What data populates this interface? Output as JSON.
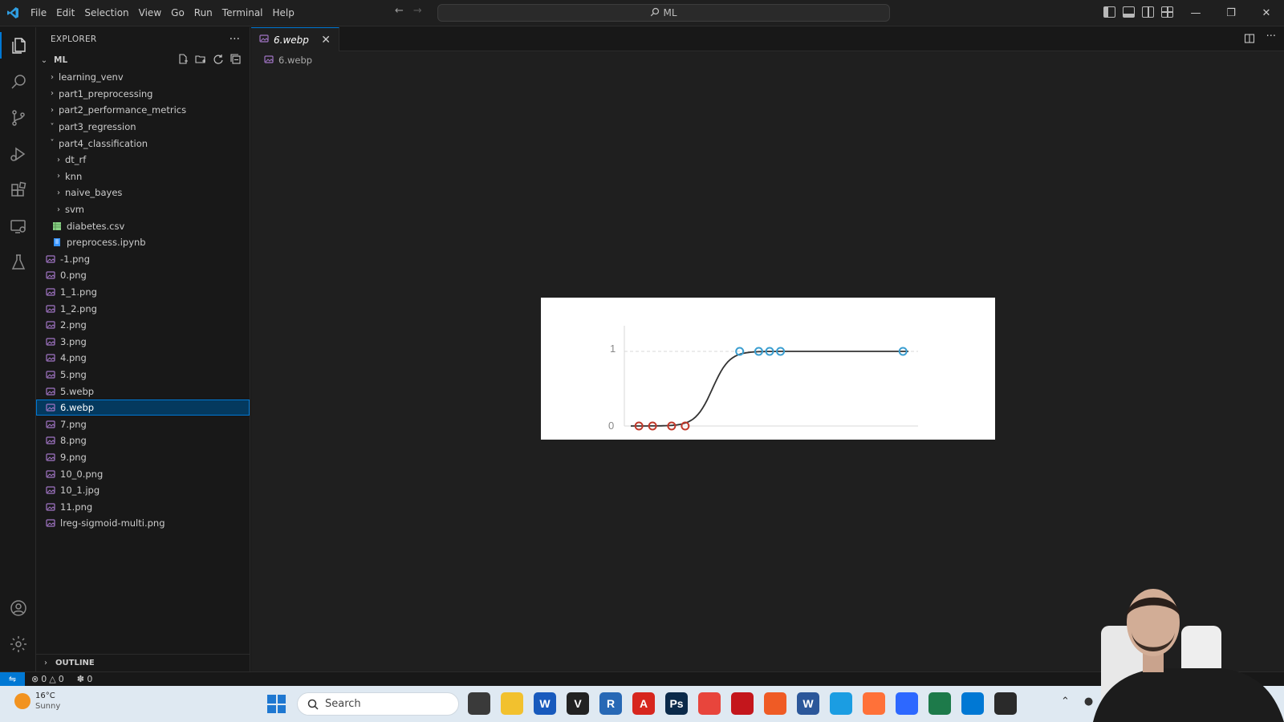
{
  "window": {
    "menu": [
      "File",
      "Edit",
      "Selection",
      "View",
      "Go",
      "Run",
      "Terminal",
      "Help"
    ],
    "search_text": "ML"
  },
  "sidebar": {
    "title": "EXPLORER",
    "root_label": "ML",
    "tree": [
      {
        "label": "learning_venv",
        "kind": "folder",
        "expanded": false,
        "depth": 1
      },
      {
        "label": "part1_preprocessing",
        "kind": "folder",
        "expanded": false,
        "depth": 1
      },
      {
        "label": "part2_performance_metrics",
        "kind": "folder",
        "expanded": false,
        "depth": 1
      },
      {
        "label": "part3_regression",
        "kind": "folder",
        "expanded": true,
        "depth": 1
      },
      {
        "label": "part4_classification",
        "kind": "folder",
        "expanded": true,
        "depth": 1
      },
      {
        "label": "dt_rf",
        "kind": "folder",
        "expanded": false,
        "depth": 2
      },
      {
        "label": "knn",
        "kind": "folder",
        "expanded": false,
        "depth": 2
      },
      {
        "label": "naive_bayes",
        "kind": "folder",
        "expanded": false,
        "depth": 2
      },
      {
        "label": "svm",
        "kind": "folder",
        "expanded": false,
        "depth": 2
      },
      {
        "label": "diabetes.csv",
        "kind": "csv",
        "depth": 2
      },
      {
        "label": "preprocess.ipynb",
        "kind": "ipynb",
        "depth": 2
      },
      {
        "label": "-1.png",
        "kind": "image",
        "depth": 1
      },
      {
        "label": "0.png",
        "kind": "image",
        "depth": 1
      },
      {
        "label": "1_1.png",
        "kind": "image",
        "depth": 1
      },
      {
        "label": "1_2.png",
        "kind": "image",
        "depth": 1
      },
      {
        "label": "2.png",
        "kind": "image",
        "depth": 1
      },
      {
        "label": "3.png",
        "kind": "image",
        "depth": 1
      },
      {
        "label": "4.png",
        "kind": "image",
        "depth": 1
      },
      {
        "label": "5.png",
        "kind": "image",
        "depth": 1
      },
      {
        "label": "5.webp",
        "kind": "image",
        "depth": 1
      },
      {
        "label": "6.webp",
        "kind": "image",
        "depth": 1,
        "selected": true
      },
      {
        "label": "7.png",
        "kind": "image",
        "depth": 1
      },
      {
        "label": "8.png",
        "kind": "image",
        "depth": 1
      },
      {
        "label": "9.png",
        "kind": "image",
        "depth": 1
      },
      {
        "label": "10_0.png",
        "kind": "image",
        "depth": 1
      },
      {
        "label": "10_1.jpg",
        "kind": "image",
        "depth": 1
      },
      {
        "label": "11.png",
        "kind": "image",
        "depth": 1
      },
      {
        "label": "lreg-sigmoid-multi.png",
        "kind": "image",
        "depth": 1
      }
    ],
    "outline_label": "OUTLINE"
  },
  "editor": {
    "tab_label": "6.webp",
    "breadcrumb": "6.webp"
  },
  "image_plot": {
    "y_tick_top": "1",
    "y_tick_bottom": "0",
    "class0_x": [
      0.3,
      0.8,
      1.5,
      2.0
    ],
    "class1_x": [
      4.0,
      4.7,
      5.1,
      5.5,
      10.0
    ],
    "curve_midpoint_x": 3.0,
    "x_max": 10.2,
    "class0_color": "#c0392b",
    "class1_color": "#3b9ed0",
    "curve_color": "#333333"
  },
  "statusbar": {
    "errors": "0",
    "warnings": "0",
    "ports": "0"
  },
  "taskbar": {
    "weather_temp": "16°C",
    "weather_condition": "Sunny",
    "search_placeholder": "Search",
    "apps": [
      {
        "name": "task-view",
        "glyph": "",
        "color": "#3a3a3a"
      },
      {
        "name": "file-explorer",
        "glyph": "",
        "color": "#f2c12e"
      },
      {
        "name": "word",
        "glyph": "W",
        "color": "#185abd"
      },
      {
        "name": "vectr",
        "glyph": "V",
        "color": "#222222"
      },
      {
        "name": "r-lang",
        "glyph": "R",
        "color": "#2768b5"
      },
      {
        "name": "acrobat",
        "glyph": "A",
        "color": "#d7261e"
      },
      {
        "name": "photoshop",
        "glyph": "Ps",
        "color": "#0b2a4a"
      },
      {
        "name": "chrome",
        "glyph": "",
        "color": "#e8453c"
      },
      {
        "name": "pdf-reader",
        "glyph": "",
        "color": "#c4161c"
      },
      {
        "name": "postman",
        "glyph": "",
        "color": "#ef5b25"
      },
      {
        "name": "word-small",
        "glyph": "W",
        "color": "#2b579a"
      },
      {
        "name": "edge",
        "glyph": "",
        "color": "#1b9de2"
      },
      {
        "name": "firefox",
        "glyph": "",
        "color": "#ff7139"
      },
      {
        "name": "zoom-like",
        "glyph": "",
        "color": "#2d68ff"
      },
      {
        "name": "mic",
        "glyph": "",
        "color": "#1d7a4a"
      },
      {
        "name": "vscode",
        "glyph": "",
        "color": "#0078d4"
      },
      {
        "name": "obs",
        "glyph": "",
        "color": "#2a2a2a"
      }
    ]
  }
}
